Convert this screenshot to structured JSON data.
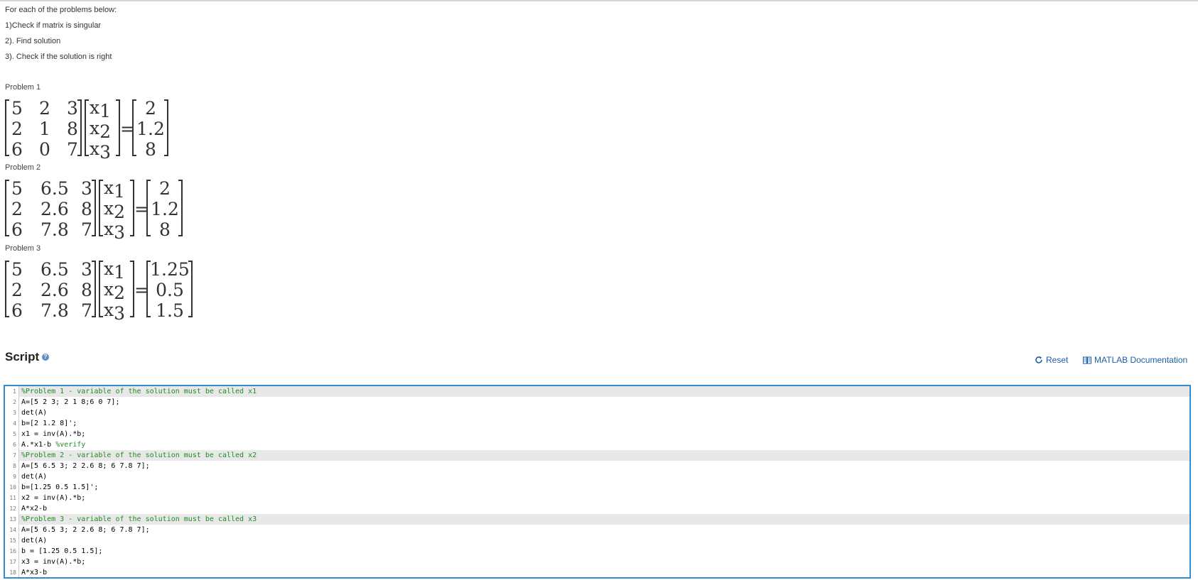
{
  "intro": {
    "lines": [
      "For each of the problems below:",
      "1)Check if matrix is singular",
      "2). Find solution",
      "3). Check if the solution is right"
    ]
  },
  "problems": [
    {
      "label": "Problem 1",
      "A": [
        [
          "5",
          "2",
          "3"
        ],
        [
          "2",
          "1",
          "8"
        ],
        [
          "6",
          "0",
          "7"
        ]
      ],
      "x_base": "x",
      "x_subs": [
        "1",
        "2",
        "3"
      ],
      "equals": "=",
      "b": [
        "2",
        "1.2",
        "8"
      ]
    },
    {
      "label": "Problem 2",
      "A": [
        [
          "5",
          "6.5",
          "3"
        ],
        [
          "2",
          "2.6",
          "8"
        ],
        [
          "6",
          "7.8",
          "7"
        ]
      ],
      "x_base": "x",
      "x_subs": [
        "1",
        "2",
        "3"
      ],
      "equals": "=",
      "b": [
        "2",
        "1.2",
        "8"
      ]
    },
    {
      "label": "Problem 3",
      "A": [
        [
          "5",
          "6.5",
          "3"
        ],
        [
          "2",
          "2.6",
          "8"
        ],
        [
          "6",
          "7.8",
          "7"
        ]
      ],
      "x_base": "x",
      "x_subs": [
        "1",
        "2",
        "3"
      ],
      "equals": "=",
      "b": [
        "1.25",
        "0.5",
        "1.5"
      ]
    }
  ],
  "script": {
    "title": "Script",
    "help_glyph": "?",
    "reset_label": "Reset",
    "doc_label": "MATLAB Documentation",
    "icons": {
      "help": "help-icon",
      "reset": "refresh-icon",
      "doc": "book-icon"
    },
    "accent_color": "#2f8ed0",
    "comment_color": "#228b22",
    "lines": [
      {
        "n": "1",
        "code": "",
        "comment": "%Problem 1 - variable of the solution must be called x1",
        "hl": true
      },
      {
        "n": "2",
        "code": "A=[5 2 3; 2 1 8;6 0 7];",
        "comment": ""
      },
      {
        "n": "3",
        "code": "det(A)",
        "comment": ""
      },
      {
        "n": "4",
        "code": "b=[2 1.2 8]';",
        "comment": ""
      },
      {
        "n": "5",
        "code": "x1 = inv(A).*b;",
        "comment": ""
      },
      {
        "n": "6",
        "code": "A.*x1-b ",
        "comment": "%verify"
      },
      {
        "n": "7",
        "code": "",
        "comment": "%Problem 2 - variable of the solution must be called x2",
        "hl": true
      },
      {
        "n": "8",
        "code": "A=[5 6.5 3; 2 2.6 8; 6 7.8 7];",
        "comment": ""
      },
      {
        "n": "9",
        "code": "det(A)",
        "comment": ""
      },
      {
        "n": "10",
        "code": "b=[1.25 0.5 1.5]';",
        "comment": ""
      },
      {
        "n": "11",
        "code": "x2 = inv(A).*b;",
        "comment": ""
      },
      {
        "n": "12",
        "code": "A*x2-b",
        "comment": ""
      },
      {
        "n": "13",
        "code": "",
        "comment": "%Problem 3 - variable of the solution must be called x3",
        "hl": true
      },
      {
        "n": "14",
        "code": "A=[5 6.5 3; 2 2.6 8; 6 7.8 7];",
        "comment": ""
      },
      {
        "n": "15",
        "code": "det(A)",
        "comment": ""
      },
      {
        "n": "16",
        "code": "b = [1.25 0.5 1.5];",
        "comment": ""
      },
      {
        "n": "17",
        "code": "x3 = inv(A).*b;",
        "comment": ""
      },
      {
        "n": "18",
        "code": "A*x3-b",
        "comment": ""
      }
    ]
  }
}
